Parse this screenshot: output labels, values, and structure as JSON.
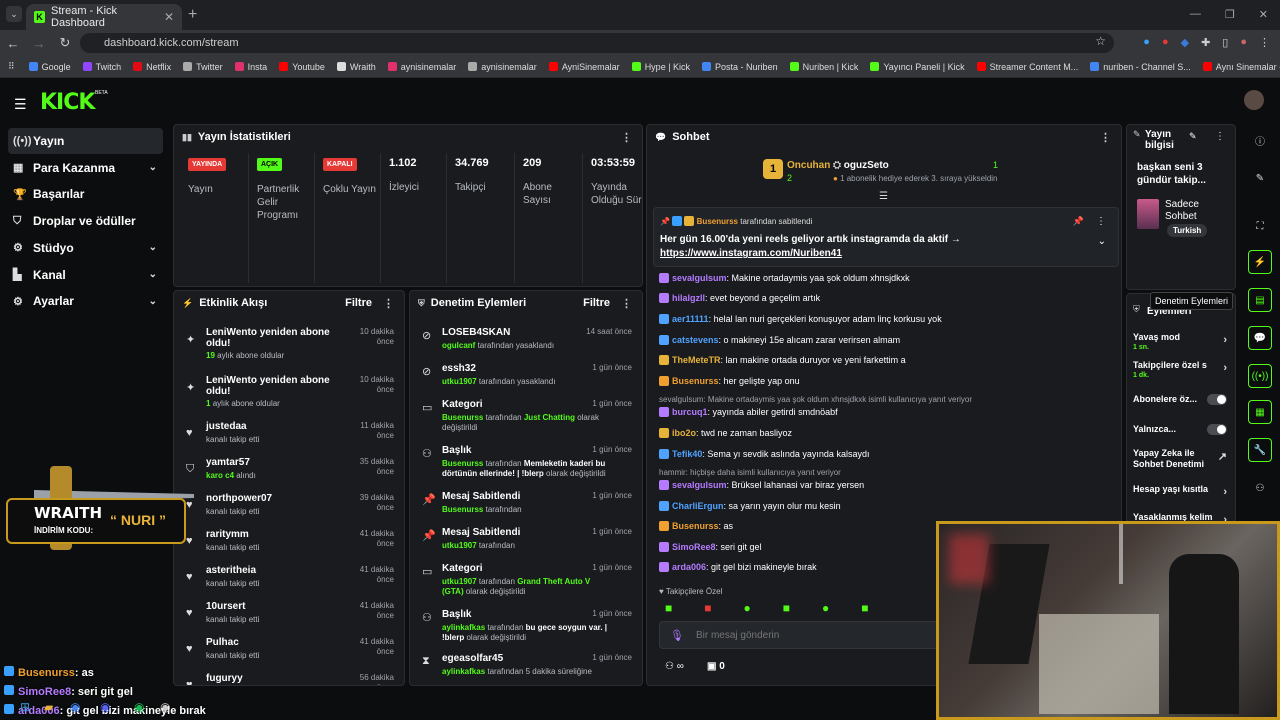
{
  "browser": {
    "tab_title": "Stream - Kick Dashboard",
    "url": "dashboard.kick.com/stream",
    "bookmarks": [
      {
        "label": "Google",
        "color": "#4285f4"
      },
      {
        "label": "Twitch",
        "color": "#9146ff"
      },
      {
        "label": "Netflix",
        "color": "#e50914"
      },
      {
        "label": "Twitter",
        "color": "#aaaaaa"
      },
      {
        "label": "Insta",
        "color": "#e1306c"
      },
      {
        "label": "Youtube",
        "color": "#ff0000"
      },
      {
        "label": "Wraith",
        "color": "#dddddd"
      },
      {
        "label": "aynisinemalar",
        "color": "#e1306c"
      },
      {
        "label": "aynisinemalar",
        "color": "#aaaaaa"
      },
      {
        "label": "AyniSinemalar",
        "color": "#ff0000"
      },
      {
        "label": "Hype | Kick",
        "color": "#53fc18"
      },
      {
        "label": "Posta - Nuriben",
        "color": "#4285f4"
      },
      {
        "label": "Nuriben | Kick",
        "color": "#53fc18"
      },
      {
        "label": "Yayıncı Paneli | Kick",
        "color": "#53fc18"
      },
      {
        "label": "Streamer Content M...",
        "color": "#ff0000"
      },
      {
        "label": "nuriben - Channel S...",
        "color": "#4285f4"
      },
      {
        "label": "Aynı Sinemalar - Ça...",
        "color": "#ff0000"
      }
    ]
  },
  "brand": {
    "logo": "KICK",
    "beta": "BETA",
    "accent": "#53fc18"
  },
  "sidebar": {
    "items": [
      {
        "label": "Yayın",
        "icon": "broadcast-icon",
        "chevron": false
      },
      {
        "label": "Para Kazanma",
        "icon": "money-icon",
        "chevron": true
      },
      {
        "label": "Başarılar",
        "icon": "trophy-icon",
        "chevron": false
      },
      {
        "label": "Droplar ve ödüller",
        "icon": "gift-icon",
        "chevron": false
      },
      {
        "label": "Stüdyo",
        "icon": "gear-icon",
        "chevron": true
      },
      {
        "label": "Kanal",
        "icon": "channel-icon",
        "chevron": true
      },
      {
        "label": "Ayarlar",
        "icon": "settings-icon",
        "chevron": true
      }
    ]
  },
  "stats": {
    "title": "Yayın İstatistikleri",
    "columns": [
      {
        "badge": "YAYINDA",
        "badge_color": "#e53935",
        "label": "Yayın"
      },
      {
        "badge": "AÇIK",
        "badge_color": "#53fc18",
        "label": "Partnerlik Gelir Programı"
      },
      {
        "badge": "KAPALI",
        "badge_color": "#e53935",
        "label": "Çoklu Yayın"
      },
      {
        "value": "1.102",
        "label": "İzleyici"
      },
      {
        "value": "34.769",
        "label": "Takipçi"
      },
      {
        "value": "209",
        "label": "Abone Sayısı"
      },
      {
        "value": "03:53:59",
        "label": "Yayında Olduğu Süre"
      }
    ]
  },
  "activity": {
    "title": "Etkinlik Akışı",
    "filter": "Filtre",
    "items": [
      {
        "title": "LeniWento yeniden abone oldu!",
        "num": "19",
        "sub": "aylık abone oldular",
        "time": "10 dakika önce",
        "icon": "sparkle-icon"
      },
      {
        "title": "LeniWento yeniden abone oldu!",
        "num": "1",
        "sub": "aylık abone oldular",
        "time": "10 dakika önce",
        "icon": "sparkle-icon"
      },
      {
        "title": "justedaa",
        "sub": "kanalı takip etti",
        "time": "11 dakika önce",
        "icon": "heart-icon"
      },
      {
        "title": "yamtar57",
        "num": "karo c4",
        "sub": "alındı",
        "time": "35 dakika önce",
        "icon": "gift-icon"
      },
      {
        "title": "northpower07",
        "sub": "kanalı takip etti",
        "time": "39 dakika önce",
        "icon": "heart-icon"
      },
      {
        "title": "raritymm",
        "sub": "kanalı takip etti",
        "time": "41 dakika önce",
        "icon": "heart-icon"
      },
      {
        "title": "asteritheia",
        "sub": "kanalı takip etti",
        "time": "41 dakika önce",
        "icon": "heart-icon"
      },
      {
        "title": "10ursert",
        "sub": "kanalı takip etti",
        "time": "41 dakika önce",
        "icon": "heart-icon"
      },
      {
        "title": "Pulhac",
        "sub": "kanalı takip etti",
        "time": "41 dakika önce",
        "icon": "heart-icon"
      },
      {
        "title": "fuguryy",
        "sub": "",
        "time": "56 dakika önce",
        "icon": "heart-icon"
      }
    ]
  },
  "moderation": {
    "title": "Denetim Eylemleri",
    "filter": "Filtre",
    "items": [
      {
        "title": "LOSEB4SKAN",
        "user": "ogulcanf",
        "text": "tarafından yasaklandı",
        "time": "14 saat önce",
        "icon": "ban-icon"
      },
      {
        "title": "essh32",
        "user": "utku1907",
        "text": "tarafından yasaklandı",
        "time": "1 gün önce",
        "icon": "ban-icon"
      },
      {
        "title": "Kategori",
        "user": "Busenurss",
        "text": "tarafından",
        "extra": "Just Chatting",
        "text2": "olarak değiştirildi",
        "time": "1 gün önce",
        "icon": "category-icon"
      },
      {
        "title": "Başlık",
        "user": "Busenurss",
        "text": "tarafından",
        "strong": "Memleketin kaderi bu dörtünün ellerinde! | !blerp",
        "text2": "olarak değiştirildi",
        "time": "1 gün önce",
        "icon": "title-icon"
      },
      {
        "title": "Mesaj Sabitlendi",
        "user": "Busenurss",
        "text": "tarafından",
        "time": "1 gün önce",
        "icon": "pin-icon"
      },
      {
        "title": "Mesaj Sabitlendi",
        "user": "utku1907",
        "text": "tarafından",
        "time": "1 gün önce",
        "icon": "pin-icon"
      },
      {
        "title": "Kategori",
        "user": "utku1907",
        "text": "tarafından",
        "extra": "Grand Theft Auto V (GTA)",
        "text2": "olarak değiştirildi",
        "time": "1 gün önce",
        "icon": "category-icon"
      },
      {
        "title": "Başlık",
        "user": "aylinkafkas",
        "text": "tarafından",
        "strong": "bu gece soygun var. | !blerp",
        "text2": "olarak değiştirildi",
        "time": "1 gün önce",
        "icon": "title-icon"
      },
      {
        "title": "egeasolfar45",
        "user": "aylinkafkas",
        "text": "tarafından 5 dakika süreliğine",
        "time": "1 gün önce",
        "icon": "timeout-icon"
      }
    ]
  },
  "chat": {
    "title": "Sohbet",
    "leader": {
      "name": "Oncuhan",
      "count": "2",
      "rank": "1",
      "user": "oguzSeto",
      "ucount": "1",
      "note": "1 abonelik hediye ederek 3. sıraya yükseldin"
    },
    "pinned": {
      "by": "Busenurss",
      "by_text": "tarafından sabitlendi",
      "text": "Her gün 16.00'da yeni reels geliyor artık instagramda da aktif →",
      "link": "https://www.instagram.com/Nuriben41"
    },
    "messages": [
      {
        "user": "sevalgulsum",
        "color": "#b57bff",
        "text": "Makine ortadaymis yaa şok oldum xhnsjdkxk"
      },
      {
        "user": "hilalgzll",
        "color": "#b57bff",
        "text": "evet beyond a geçelim artık"
      },
      {
        "user": "aer11111",
        "color": "#4fa3ff",
        "text": "helal lan nuri gerçekleri konuşuyor adam linç korkusu yok"
      },
      {
        "user": "catstevens",
        "color": "#4fa3ff",
        "text": "o makineyi 15e alıcam zarar verirsen almam"
      },
      {
        "user": "TheMeteTR",
        "color": "#e8b339",
        "text": "lan makine ortada duruyor ve yeni farkettim a"
      },
      {
        "user": "Busenurss",
        "color": "#f0a030",
        "text": "her gelişte yap onu"
      },
      {
        "reply": "sevalgulsum: Makine ortadaymis yaa şok oldum xhnsjdkxk isimli kullanıcıya yanıt veriyor"
      },
      {
        "user": "burcuq1",
        "color": "#b57bff",
        "text": "yayında abiler getirdi smdnöabf"
      },
      {
        "user": "ibo2o",
        "color": "#e8b339",
        "text": "twd ne zaman basliyoz"
      },
      {
        "user": "Tefik40",
        "color": "#4fa3ff",
        "text": "Sema yı sevdik aslında yayında kalsaydı"
      },
      {
        "reply": "hammir: hiçbişe daha isimli kullanıcıya yanıt veriyor"
      },
      {
        "user": "sevalgulsum",
        "color": "#b57bff",
        "text": "Brüksel lahanasi var biraz yersen"
      },
      {
        "user": "CharliErgun",
        "color": "#4fa3ff",
        "text": "sa yarın yayın olur mu kesin"
      },
      {
        "user": "Busenurss",
        "color": "#f0a030",
        "text": "as"
      },
      {
        "user": "SimoRee8",
        "color": "#b57bff",
        "text": "seri git gel"
      },
      {
        "user": "arda006",
        "color": "#b57bff",
        "text": "git gel bizi makineyle bırak"
      }
    ],
    "followers_label": "Takipçilere Özel",
    "placeholder": "Bir mesaj gönderin",
    "points": "0"
  },
  "stream_info": {
    "title": "Yayın bilgisi",
    "stream_title": "başkan seni 3 gündür takip...",
    "chat_mode": "Sadece Sohbet",
    "language": "Turkish"
  },
  "mod_actions": {
    "tooltip": "Denetim Eylemleri",
    "header": "Eylemleri",
    "items": [
      {
        "label": "Yavaş mod",
        "sub": "1 sn.",
        "type": "arrow"
      },
      {
        "label": "Takipçilere özel s",
        "sub": "1 dk.",
        "type": "arrow"
      },
      {
        "label": "Abonelere öz...",
        "type": "toggle"
      },
      {
        "label": "Yalnızca...",
        "type": "toggle"
      },
      {
        "label": "Yapay Zeka ile Sohbet Denetimi",
        "type": "link"
      },
      {
        "label": "Hesap yaşı kısıtla",
        "type": "arrow"
      },
      {
        "label": "Yasaklanmış kelim",
        "type": "arrow"
      }
    ]
  },
  "overlay": {
    "wraith_title": "WRAITH",
    "promo_label": "İNDİRİM KODU:",
    "promo_code": "NURI",
    "chat": [
      {
        "user": "Busenurss",
        "text": ": as"
      },
      {
        "user": "SimoRee8",
        "text": ": seri git gel"
      },
      {
        "user": "arda006",
        "text": ": git gel bizi makineyle bırak"
      }
    ]
  }
}
